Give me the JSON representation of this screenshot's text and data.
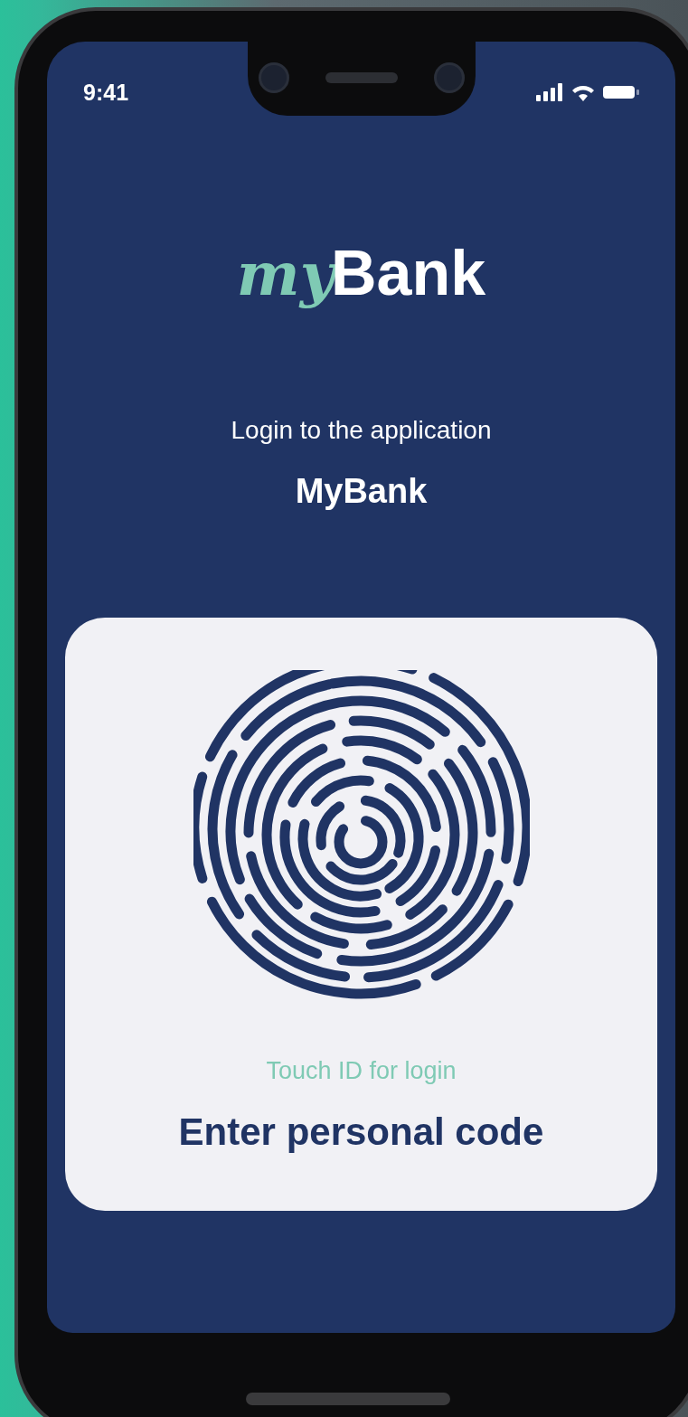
{
  "status_bar": {
    "time": "9:41"
  },
  "logo": {
    "script": "my",
    "bold": "Bank"
  },
  "header": {
    "subtitle": "Login to the application",
    "title": "MyBank"
  },
  "card": {
    "touch_id_label": "Touch ID for login",
    "code_button": "Enter personal code"
  }
}
